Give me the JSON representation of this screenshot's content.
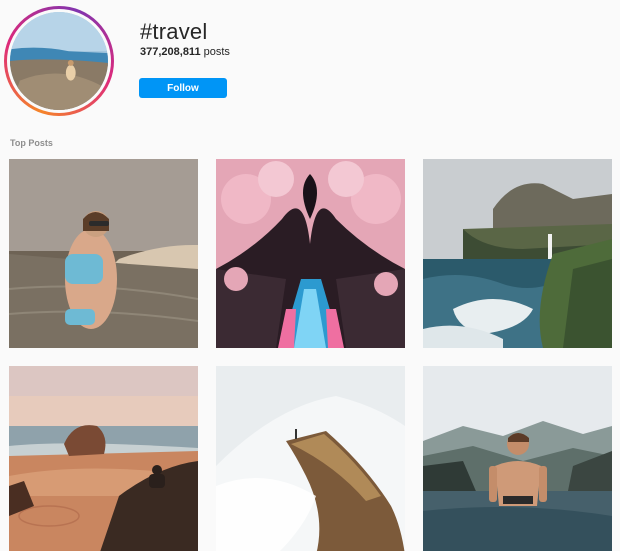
{
  "hashtag": {
    "title": "#travel",
    "post_count": "377,208,811",
    "post_count_suffix": " posts",
    "follow_label": "Follow"
  },
  "section": {
    "top_posts_label": "Top Posts"
  },
  "posts": [
    {
      "subject": "woman in swimsuit in sea near sand dunes"
    },
    {
      "subject": "cherry blossom tunnel over canal"
    },
    {
      "subject": "waterfall into ocean from cliffs"
    },
    {
      "subject": "person sitting on rocks at sunset beach"
    },
    {
      "subject": "person on ridge above clouds"
    },
    {
      "subject": "man in infinity pool with mountains"
    }
  ],
  "colors": {
    "accent": "#0095f6",
    "background": "#fafafa",
    "muted_text": "#8e8e8e"
  }
}
